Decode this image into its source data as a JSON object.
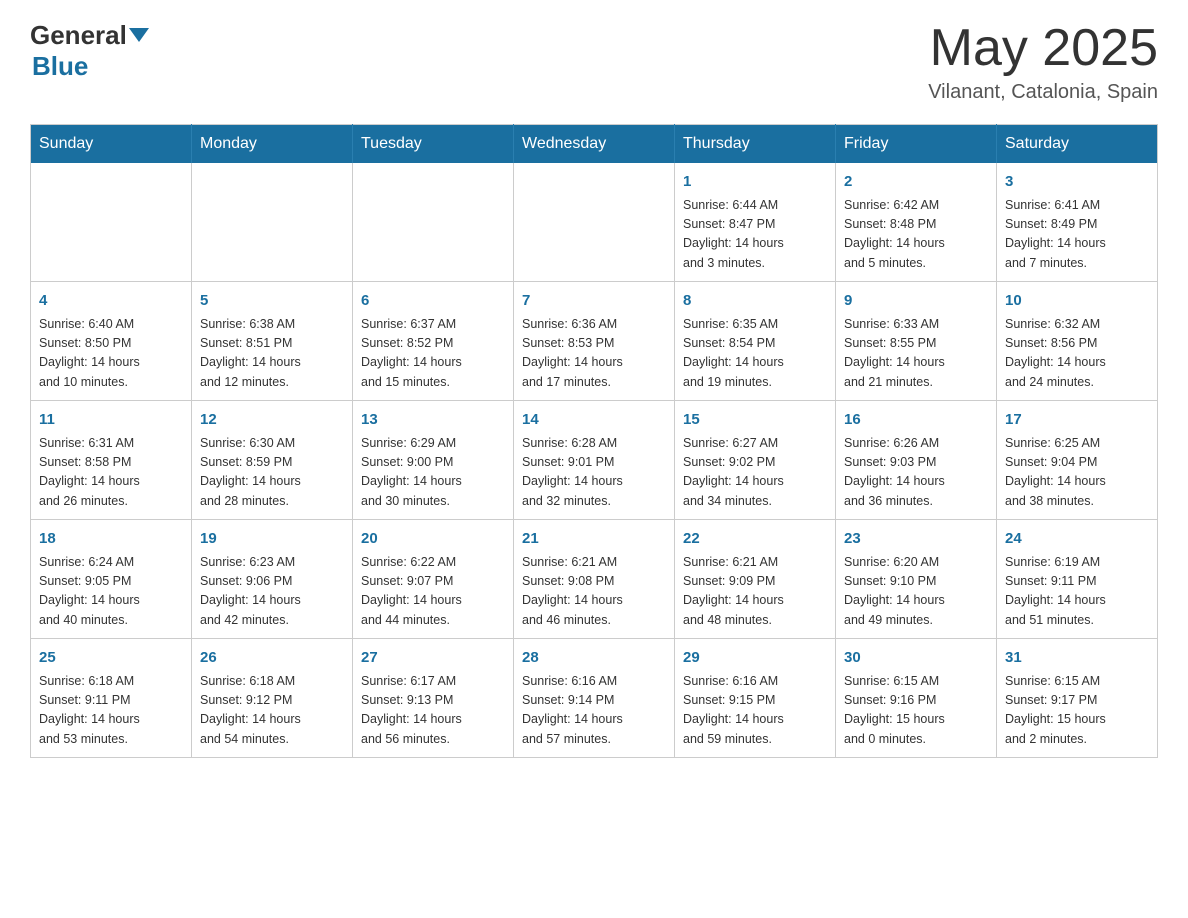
{
  "header": {
    "logo_general": "General",
    "logo_blue": "Blue",
    "month_title": "May 2025",
    "location": "Vilanant, Catalonia, Spain"
  },
  "weekdays": [
    "Sunday",
    "Monday",
    "Tuesday",
    "Wednesday",
    "Thursday",
    "Friday",
    "Saturday"
  ],
  "weeks": [
    [
      {
        "day": "",
        "info": ""
      },
      {
        "day": "",
        "info": ""
      },
      {
        "day": "",
        "info": ""
      },
      {
        "day": "",
        "info": ""
      },
      {
        "day": "1",
        "info": "Sunrise: 6:44 AM\nSunset: 8:47 PM\nDaylight: 14 hours\nand 3 minutes."
      },
      {
        "day": "2",
        "info": "Sunrise: 6:42 AM\nSunset: 8:48 PM\nDaylight: 14 hours\nand 5 minutes."
      },
      {
        "day": "3",
        "info": "Sunrise: 6:41 AM\nSunset: 8:49 PM\nDaylight: 14 hours\nand 7 minutes."
      }
    ],
    [
      {
        "day": "4",
        "info": "Sunrise: 6:40 AM\nSunset: 8:50 PM\nDaylight: 14 hours\nand 10 minutes."
      },
      {
        "day": "5",
        "info": "Sunrise: 6:38 AM\nSunset: 8:51 PM\nDaylight: 14 hours\nand 12 minutes."
      },
      {
        "day": "6",
        "info": "Sunrise: 6:37 AM\nSunset: 8:52 PM\nDaylight: 14 hours\nand 15 minutes."
      },
      {
        "day": "7",
        "info": "Sunrise: 6:36 AM\nSunset: 8:53 PM\nDaylight: 14 hours\nand 17 minutes."
      },
      {
        "day": "8",
        "info": "Sunrise: 6:35 AM\nSunset: 8:54 PM\nDaylight: 14 hours\nand 19 minutes."
      },
      {
        "day": "9",
        "info": "Sunrise: 6:33 AM\nSunset: 8:55 PM\nDaylight: 14 hours\nand 21 minutes."
      },
      {
        "day": "10",
        "info": "Sunrise: 6:32 AM\nSunset: 8:56 PM\nDaylight: 14 hours\nand 24 minutes."
      }
    ],
    [
      {
        "day": "11",
        "info": "Sunrise: 6:31 AM\nSunset: 8:58 PM\nDaylight: 14 hours\nand 26 minutes."
      },
      {
        "day": "12",
        "info": "Sunrise: 6:30 AM\nSunset: 8:59 PM\nDaylight: 14 hours\nand 28 minutes."
      },
      {
        "day": "13",
        "info": "Sunrise: 6:29 AM\nSunset: 9:00 PM\nDaylight: 14 hours\nand 30 minutes."
      },
      {
        "day": "14",
        "info": "Sunrise: 6:28 AM\nSunset: 9:01 PM\nDaylight: 14 hours\nand 32 minutes."
      },
      {
        "day": "15",
        "info": "Sunrise: 6:27 AM\nSunset: 9:02 PM\nDaylight: 14 hours\nand 34 minutes."
      },
      {
        "day": "16",
        "info": "Sunrise: 6:26 AM\nSunset: 9:03 PM\nDaylight: 14 hours\nand 36 minutes."
      },
      {
        "day": "17",
        "info": "Sunrise: 6:25 AM\nSunset: 9:04 PM\nDaylight: 14 hours\nand 38 minutes."
      }
    ],
    [
      {
        "day": "18",
        "info": "Sunrise: 6:24 AM\nSunset: 9:05 PM\nDaylight: 14 hours\nand 40 minutes."
      },
      {
        "day": "19",
        "info": "Sunrise: 6:23 AM\nSunset: 9:06 PM\nDaylight: 14 hours\nand 42 minutes."
      },
      {
        "day": "20",
        "info": "Sunrise: 6:22 AM\nSunset: 9:07 PM\nDaylight: 14 hours\nand 44 minutes."
      },
      {
        "day": "21",
        "info": "Sunrise: 6:21 AM\nSunset: 9:08 PM\nDaylight: 14 hours\nand 46 minutes."
      },
      {
        "day": "22",
        "info": "Sunrise: 6:21 AM\nSunset: 9:09 PM\nDaylight: 14 hours\nand 48 minutes."
      },
      {
        "day": "23",
        "info": "Sunrise: 6:20 AM\nSunset: 9:10 PM\nDaylight: 14 hours\nand 49 minutes."
      },
      {
        "day": "24",
        "info": "Sunrise: 6:19 AM\nSunset: 9:11 PM\nDaylight: 14 hours\nand 51 minutes."
      }
    ],
    [
      {
        "day": "25",
        "info": "Sunrise: 6:18 AM\nSunset: 9:11 PM\nDaylight: 14 hours\nand 53 minutes."
      },
      {
        "day": "26",
        "info": "Sunrise: 6:18 AM\nSunset: 9:12 PM\nDaylight: 14 hours\nand 54 minutes."
      },
      {
        "day": "27",
        "info": "Sunrise: 6:17 AM\nSunset: 9:13 PM\nDaylight: 14 hours\nand 56 minutes."
      },
      {
        "day": "28",
        "info": "Sunrise: 6:16 AM\nSunset: 9:14 PM\nDaylight: 14 hours\nand 57 minutes."
      },
      {
        "day": "29",
        "info": "Sunrise: 6:16 AM\nSunset: 9:15 PM\nDaylight: 14 hours\nand 59 minutes."
      },
      {
        "day": "30",
        "info": "Sunrise: 6:15 AM\nSunset: 9:16 PM\nDaylight: 15 hours\nand 0 minutes."
      },
      {
        "day": "31",
        "info": "Sunrise: 6:15 AM\nSunset: 9:17 PM\nDaylight: 15 hours\nand 2 minutes."
      }
    ]
  ]
}
